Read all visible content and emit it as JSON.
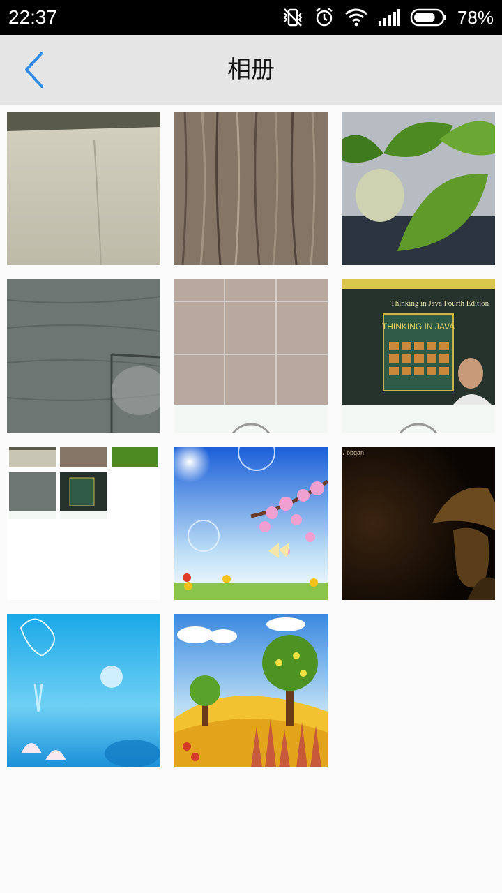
{
  "status_bar": {
    "time": "22:37",
    "battery_percent": "78%",
    "battery_level": 0.78,
    "icons": [
      "vibrate-off-icon",
      "alarm-icon",
      "wifi-icon",
      "signal-icon",
      "battery-icon"
    ]
  },
  "nav": {
    "back_icon": "chevron-left-icon",
    "title": "相册",
    "accent_color": "#2f8be6"
  },
  "photos": [
    {
      "name": "cardboard"
    },
    {
      "name": "wood-grain"
    },
    {
      "name": "plant-leaves"
    },
    {
      "name": "gray-floor"
    },
    {
      "name": "tile-grid"
    },
    {
      "name": "java-book",
      "book_title": "THINKING IN JAVA",
      "book_edition": "Thinking in Java Fourth Edition"
    },
    {
      "name": "photo-collage"
    },
    {
      "name": "flower-butterfly"
    },
    {
      "name": "dark-portrait",
      "caption": "/ bbgan"
    },
    {
      "name": "blue-lotus"
    },
    {
      "name": "cartoon-landscape"
    }
  ]
}
